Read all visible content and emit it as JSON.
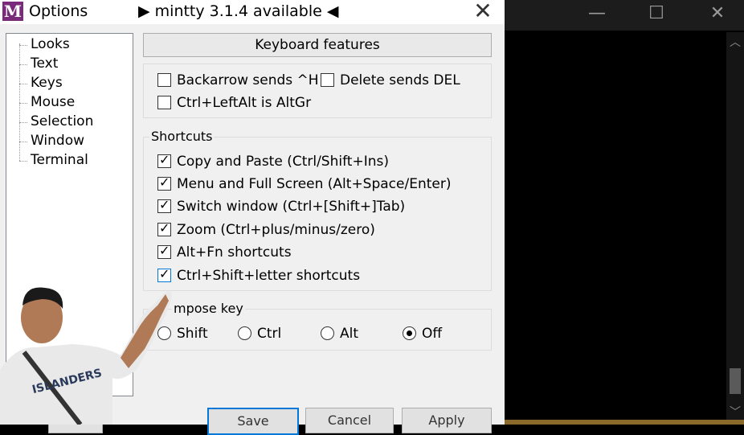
{
  "window": {
    "title": "Options",
    "update_notice": "▶ mintty 3.1.4 available ◀",
    "icon": "mintty-icon"
  },
  "sidebar": {
    "items": [
      {
        "label": "Looks"
      },
      {
        "label": "Text"
      },
      {
        "label": "Keys",
        "selected": true
      },
      {
        "label": "Mouse"
      },
      {
        "label": "Selection"
      },
      {
        "label": "Window"
      },
      {
        "label": "Terminal"
      }
    ]
  },
  "section_title": "Keyboard features",
  "keyboard": {
    "backarrow": {
      "label": "Backarrow sends ^H",
      "checked": false
    },
    "delete": {
      "label": "Delete sends DEL",
      "checked": false
    },
    "altgr": {
      "label": "Ctrl+LeftAlt is AltGr",
      "checked": false
    }
  },
  "shortcuts": {
    "label": "Shortcuts",
    "items": [
      {
        "label": "Copy and Paste (Ctrl/Shift+Ins)",
        "checked": true
      },
      {
        "label": "Menu and Full Screen (Alt+Space/Enter)",
        "checked": true
      },
      {
        "label": "Switch window (Ctrl+[Shift+]Tab)",
        "checked": true
      },
      {
        "label": "Zoom (Ctrl+plus/minus/zero)",
        "checked": true
      },
      {
        "label": "Alt+Fn shortcuts",
        "checked": true
      },
      {
        "label": "Ctrl+Shift+letter shortcuts",
        "checked": true
      }
    ]
  },
  "compose": {
    "label": "mpose key",
    "options": [
      {
        "label": "Shift",
        "selected": false
      },
      {
        "label": "Ctrl",
        "selected": false
      },
      {
        "label": "Alt",
        "selected": false
      },
      {
        "label": "Off",
        "selected": true
      }
    ]
  },
  "buttons": {
    "save": "Save",
    "cancel": "Cancel",
    "apply": "Apply"
  },
  "colors": {
    "accent": "#0078d7",
    "dialog_bg": "#f0f0f0",
    "icon_bg": "#7a2a7a"
  }
}
